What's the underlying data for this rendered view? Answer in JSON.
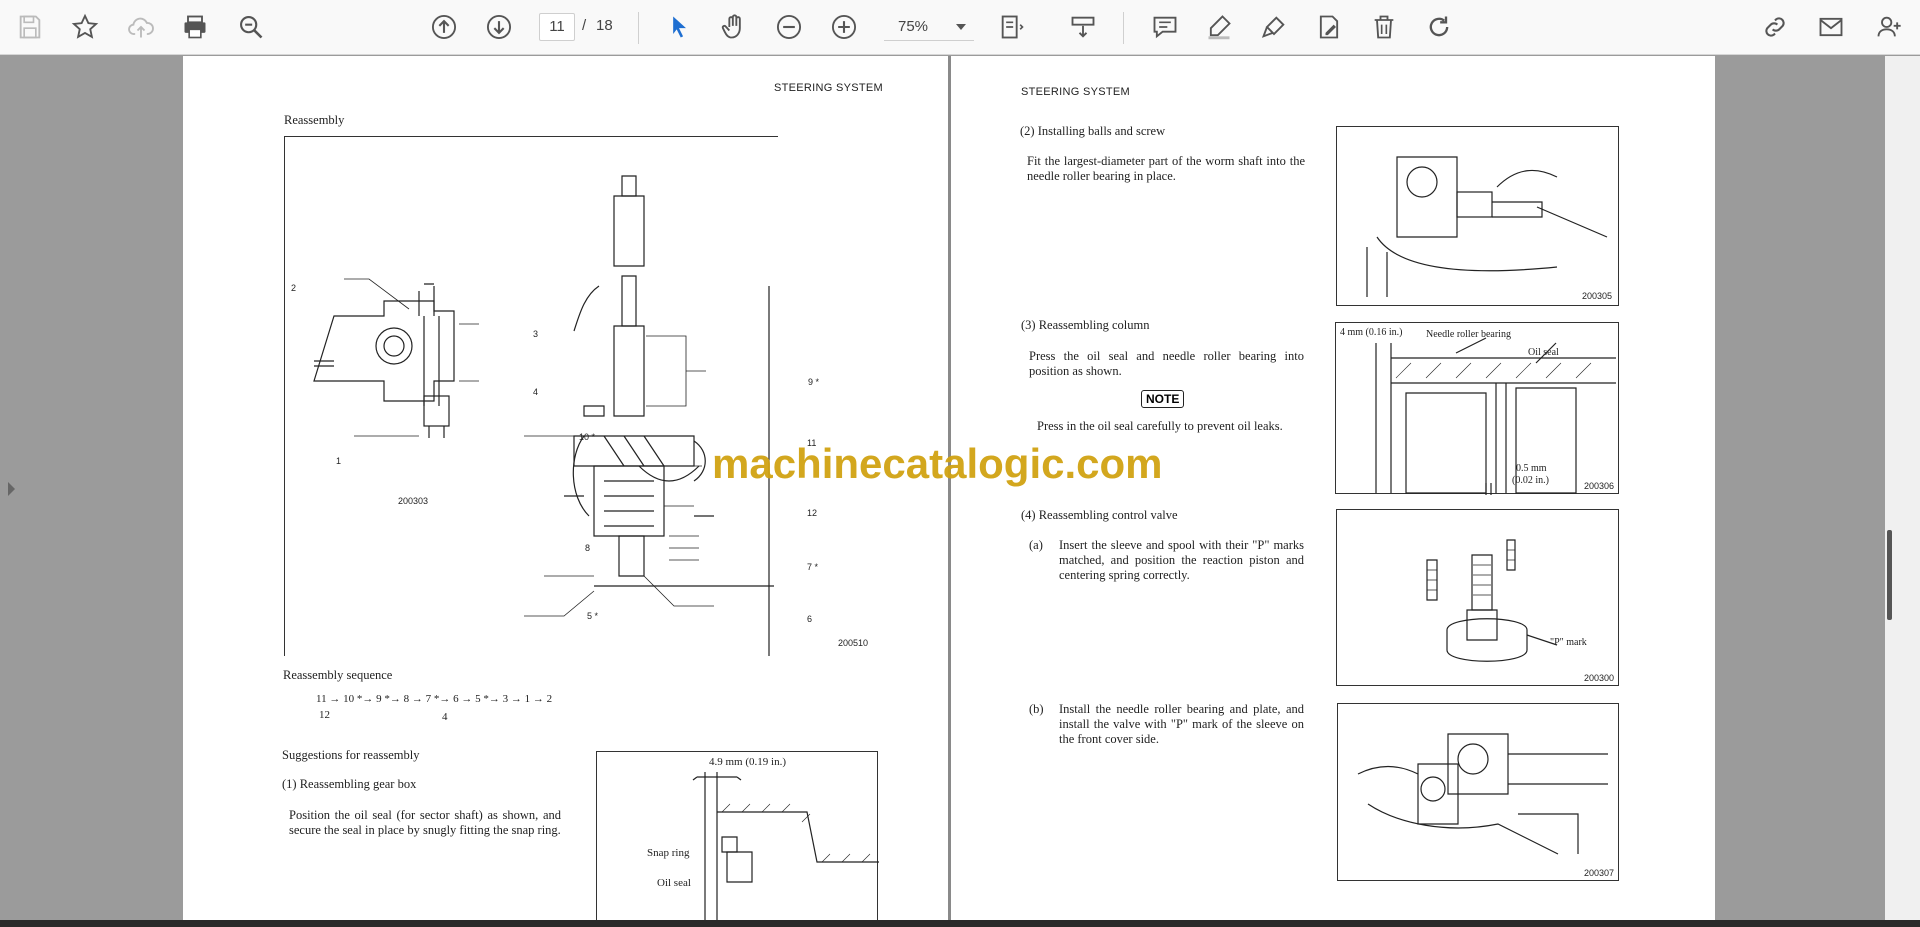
{
  "toolbar": {
    "icons": [
      "save-icon",
      "bookmark-star-icon",
      "cloud-upload-icon",
      "print-icon",
      "zoom-out-search-icon",
      "previous-page-icon",
      "next-page-icon",
      "select-cursor-icon",
      "hand-pan-icon",
      "zoom-out-icon",
      "zoom-in-icon",
      "page-fit-icon",
      "scroll-mode-icon",
      "comment-icon",
      "highlight-pen-icon",
      "draw-sign-icon",
      "edit-page-icon",
      "delete-icon",
      "rotate-icon",
      "share-link-icon",
      "email-icon",
      "add-user-icon"
    ],
    "current_page": "11",
    "page_separator": "/",
    "total_pages": "18",
    "zoom": "75%"
  },
  "left_page": {
    "header": "STEERING SYSTEM",
    "section_title": "Reassembly",
    "fig_ids": {
      "small": "200303",
      "large": "200510"
    },
    "callouts": {
      "c2": "2",
      "c3": "3",
      "c4": "4",
      "c1": "1",
      "c9": "9 *",
      "c10": "10 *",
      "c11": "11",
      "c12": "12",
      "c8": "8",
      "c7": "7 *",
      "c5": "5 *",
      "c6": "6"
    },
    "sequence_title": "Reassembly sequence",
    "sequence_line": "11 → 10 *→ 9 *→ 8 → 7 *→ 6 → 5 *→ 3 → 1 → 2",
    "sequence_sub_12": "12",
    "sequence_sub_4": "4",
    "suggestions_title": "Suggestions for reassembly",
    "item1_title": "(1)  Reassembling gear box",
    "item1_text": "Position the oil seal (for sector shaft) as shown, and secure the seal in place by snugly fitting the snap ring.",
    "fig3": {
      "dim": "4.9 mm (0.19 in.)",
      "snap": "Snap ring",
      "oil": "Oil seal"
    }
  },
  "right_page": {
    "header": "STEERING SYSTEM",
    "item2_title": "(2)  Installing balls and screw",
    "item2_text": "Fit the largest-diameter part of the worm shaft into the needle roller bearing in place.",
    "fig_a_id": "200305",
    "item3_title": "(3)  Reassembling column",
    "item3_text": "Press the oil seal and needle roller bearing into position as shown.",
    "note_label": "NOTE",
    "note_text": "Press in the oil seal carefully to prevent oil leaks.",
    "fig_b": {
      "dim1": "4 mm (0.16 in.)",
      "bearing": "Needle roller bearing",
      "seal": "Oil seal",
      "dim2a": "0.5 mm",
      "dim2b": "(0.02 in.)",
      "id": "200306"
    },
    "item4_title": "(4)  Reassembling control valve",
    "item4a_label": "(a)",
    "item4a_text": "Insert the sleeve and spool with their \"P\" marks matched, and position the reaction piston and centering spring correctly.",
    "fig_c": {
      "mark": "\"P\" mark",
      "id": "200300"
    },
    "item4b_label": "(b)",
    "item4b_text": "Install the needle roller bearing and plate, and install the valve with \"P\" mark of the sleeve on the front cover side.",
    "fig_d_id": "200307"
  },
  "watermark": "machinecatalogic.com"
}
